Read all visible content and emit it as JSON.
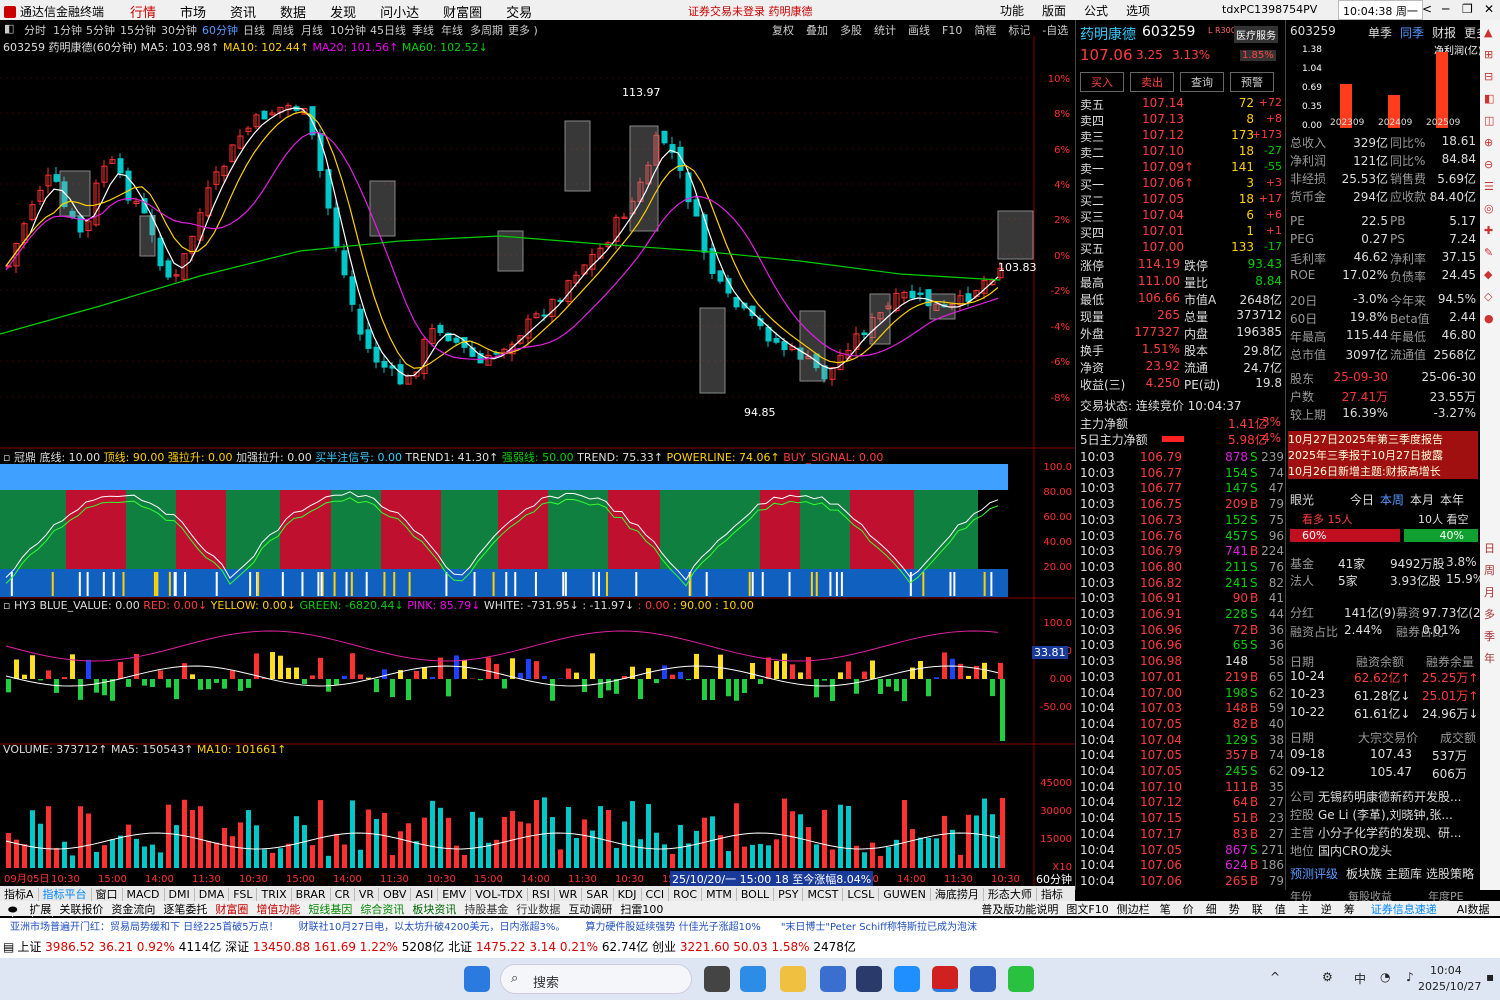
{
  "window": {
    "title": "通达信金融终端",
    "menus": [
      "行情",
      "市场",
      "资讯",
      "数据",
      "发现",
      "问小达",
      "财富圈",
      "交易"
    ],
    "active_menu": "行情",
    "notice": "证券交易未登录  药明康德",
    "right_menus": [
      "功能",
      "版面",
      "公式",
      "选项"
    ],
    "user": "tdxPC1398754PV",
    "clock": "10:04:38 周一"
  },
  "periods": [
    "分时",
    "1分钟",
    "5分钟",
    "15分钟",
    "30分钟",
    "60分钟",
    "日线",
    "周线",
    "月线",
    "10分钟",
    "45日线",
    "季线",
    "年线",
    "多周期",
    "更多 )"
  ],
  "active_period": "60分钟",
  "toolbar_right": [
    "复权",
    "叠加",
    "多股",
    "统计",
    "画线",
    "F10",
    "简框",
    "标记",
    "-自选",
    "返回"
  ],
  "chart": {
    "stock_header": "603259 药明康德(60分钟)",
    "ma5": "MA5: 103.98↑",
    "ma10": "MA10: 102.44↑",
    "ma20": "MA20: 101.56↑",
    "ma60": "MA60: 102.52↓",
    "high_label": "113.97",
    "low_label": "94.85",
    "last_label": "103.83",
    "pct_ticks": [
      "10%",
      "8%",
      "6%",
      "4%",
      "2%",
      "0%",
      "-2%",
      "-4%",
      "-6%",
      "-8%"
    ]
  },
  "ind1": {
    "name": "冠鼎",
    "items": [
      {
        "t": "底线: 10.00",
        "c": "wht"
      },
      {
        "t": "顶线: 90.00",
        "c": "yel"
      },
      {
        "t": "强拉升: 0.00",
        "c": "yel"
      },
      {
        "t": "加强拉升: 0.00",
        "c": "wht"
      },
      {
        "t": "买半注信号: 0.00",
        "c": "cyan"
      },
      {
        "t": "TREND1: 41.30↑",
        "c": "wht"
      },
      {
        "t": "强弱线: 50.00",
        "c": "green"
      },
      {
        "t": "TREND: 75.33↑",
        "c": "wht"
      },
      {
        "t": "POWERLINE: 74.06↑",
        "c": "yel"
      },
      {
        "t": "BUY_SIGNAL: 0.00",
        "c": "red"
      }
    ],
    "ticks": [
      "100.0",
      "80.00",
      "60.00",
      "40.00",
      "20.00"
    ]
  },
  "ind2": {
    "name": "HY3",
    "items": [
      {
        "t": "BLUE_VALUE: 0.00",
        "c": "wht"
      },
      {
        "t": "RED: 0.00↓",
        "c": "red"
      },
      {
        "t": "YELLOW: 0.00↓",
        "c": "yel"
      },
      {
        "t": "GREEN: -6820.44↓",
        "c": "green"
      },
      {
        "t": "PINK: 85.79↓",
        "c": "mag"
      },
      {
        "t": "WHITE: -731.95↓",
        "c": "wht"
      },
      {
        "t": ": -11.97↓",
        "c": "wht"
      },
      {
        "t": ": 0.00",
        "c": "red"
      },
      {
        "t": ": 90.00",
        "c": "yel"
      },
      {
        "t": ": 10.00",
        "c": "yel"
      }
    ],
    "ticks": [
      "100.0",
      "50.00",
      "0.00",
      "-50.00"
    ],
    "marker": "33.81"
  },
  "ind3": {
    "volume": "VOLUME: 373712↑",
    "ma5": "MA5: 150543↑",
    "ma10": "MA10: 101661↑",
    "ticks": [
      "45000",
      "30000",
      "15000",
      "X10"
    ],
    "tooltip": "25/10/20/一 15:00 18 至今涨幅8.04%"
  },
  "time_axis": [
    "09月05日",
    "10:30",
    "15:00",
    "14:00",
    "11:30",
    "10:30",
    "15:00",
    "14:00",
    "11:30",
    "10:30",
    "15:00",
    "14:00",
    "11:30",
    "10:30",
    "15:00",
    "14:00",
    "11:30",
    "10:30",
    "15:00",
    "14:00",
    "11:30",
    "10:30"
  ],
  "right": {
    "name": "药明康德",
    "code": "603259",
    "tag": "L R300",
    "service": "医疗服务",
    "price": "107.06",
    "change": "3.25",
    "pct": "3.13%",
    "service_pct": "1.85%",
    "buttons": [
      "买入",
      "卖出",
      "查询",
      "预警"
    ],
    "asks": [
      {
        "n": "卖五",
        "p": "107.14",
        "v": "72",
        "d": "+72"
      },
      {
        "n": "卖四",
        "p": "107.13",
        "v": "8",
        "d": "+8"
      },
      {
        "n": "卖三",
        "p": "107.12",
        "v": "173",
        "d": "+173"
      },
      {
        "n": "卖二",
        "p": "107.10",
        "v": "18",
        "d": "-27"
      },
      {
        "n": "卖一",
        "p": "107.09↑",
        "v": "141",
        "d": "-55"
      }
    ],
    "bids": [
      {
        "n": "买一",
        "p": "107.06↑",
        "v": "3",
        "d": "+3"
      },
      {
        "n": "买二",
        "p": "107.05",
        "v": "18",
        "d": "+17"
      },
      {
        "n": "买三",
        "p": "107.04",
        "v": "6",
        "d": "+6"
      },
      {
        "n": "买四",
        "p": "107.01",
        "v": "1",
        "d": "+1"
      },
      {
        "n": "买五",
        "p": "107.00",
        "v": "133",
        "d": "-17"
      }
    ],
    "stats": [
      [
        "涨停",
        "114.19",
        "跌停",
        "93.43"
      ],
      [
        "最高",
        "111.00",
        "量比",
        "8.84"
      ],
      [
        "最低",
        "106.66",
        "市值A",
        "2648亿"
      ],
      [
        "现量",
        "265",
        "总量",
        "373712"
      ],
      [
        "外盘",
        "177327",
        "内盘",
        "196385"
      ],
      [
        "换手",
        "1.51%",
        "股本",
        "29.8亿"
      ],
      [
        "净资",
        "23.92",
        "流通",
        "24.7亿"
      ],
      [
        "收益(三)",
        "4.250",
        "PE(动)",
        "19.8"
      ]
    ],
    "status": "交易状态: 连续竞价 10:04:37",
    "main_flow": "主力净额",
    "main_flow_v": "1.41亿",
    "main_flow_p": "3%",
    "main5": "5日主力净额",
    "main5_v": "5.98亿",
    "main5_p": "4%",
    "ticks": [
      [
        "10:03",
        "106.79",
        "878",
        "S",
        "239"
      ],
      [
        "10:03",
        "106.77",
        "154",
        "S",
        "74"
      ],
      [
        "10:03",
        "106.77",
        "147",
        "S",
        "47"
      ],
      [
        "10:03",
        "106.75",
        "209",
        "B",
        "79"
      ],
      [
        "10:03",
        "106.73",
        "152",
        "S",
        "75"
      ],
      [
        "10:03",
        "106.76",
        "457",
        "S",
        "96"
      ],
      [
        "10:03",
        "106.79",
        "741",
        "B",
        "224"
      ],
      [
        "10:03",
        "106.80",
        "211",
        "S",
        "76"
      ],
      [
        "10:03",
        "106.82",
        "241",
        "S",
        "82"
      ],
      [
        "10:03",
        "106.91",
        "90",
        "B",
        "41"
      ],
      [
        "10:03",
        "106.91",
        "228",
        "S",
        "44"
      ],
      [
        "10:03",
        "106.96",
        "72",
        "B",
        "36"
      ],
      [
        "10:03",
        "106.96",
        "65",
        "S",
        "36"
      ],
      [
        "10:03",
        "106.98",
        "148",
        "",
        "58"
      ],
      [
        "10:03",
        "107.01",
        "219",
        "B",
        "65"
      ],
      [
        "10:04",
        "107.00",
        "198",
        "S",
        "62"
      ],
      [
        "10:04",
        "107.03",
        "148",
        "B",
        "59"
      ],
      [
        "10:04",
        "107.05",
        "82",
        "B",
        "40"
      ],
      [
        "10:04",
        "107.04",
        "129",
        "S",
        "38"
      ],
      [
        "10:04",
        "107.05",
        "357",
        "B",
        "74"
      ],
      [
        "10:04",
        "107.05",
        "245",
        "S",
        "62"
      ],
      [
        "10:04",
        "107.10",
        "111",
        "B",
        "35"
      ],
      [
        "10:04",
        "107.12",
        "64",
        "B",
        "27"
      ],
      [
        "10:04",
        "107.15",
        "51",
        "B",
        "23"
      ],
      [
        "10:04",
        "107.17",
        "83",
        "B",
        "27"
      ],
      [
        "10:04",
        "107.05",
        "867",
        "S",
        "271"
      ],
      [
        "10:04",
        "107.06",
        "624",
        "B",
        "186"
      ],
      [
        "10:04",
        "107.06",
        "265",
        "B",
        "79"
      ]
    ]
  },
  "far": {
    "code": "603259",
    "tabs": [
      "单季",
      "同季",
      "财报",
      "更多.."
    ],
    "bar_legend": "净利润(亿)",
    "bar_y": [
      "1.38",
      "1.04",
      "0.69",
      "0.35",
      "0.00"
    ],
    "bar_x": [
      "202309",
      "202409",
      "202509"
    ],
    "bars": [
      0.8,
      0.6,
      1.38
    ],
    "fin": [
      [
        "总收入",
        "329亿",
        "同比%",
        "18.61"
      ],
      [
        "净利润",
        "121亿",
        "同比%",
        "84.84"
      ],
      [
        "非经损",
        "25.53亿",
        "销售费",
        "5.69亿"
      ],
      [
        "货币金",
        "294亿",
        "应收款",
        "84.40亿"
      ],
      [
        "PE",
        "22.5",
        "PB",
        "5.17"
      ],
      [
        "PEG",
        "0.27",
        "PS",
        "7.24"
      ],
      [
        "毛利率",
        "46.62",
        "净利率",
        "37.15"
      ],
      [
        "ROE",
        "17.02%",
        "负债率",
        "24.45"
      ],
      [
        "20日",
        "-3.0%",
        "今年来",
        "94.5%"
      ],
      [
        "60日",
        "19.8%",
        "Beta值",
        "2.44"
      ],
      [
        "年最高",
        "115.44",
        "年最低",
        "46.80"
      ],
      [
        "总市值",
        "3097亿",
        "流通值",
        "2568亿"
      ],
      [
        "股东",
        "25-09-30",
        "",
        "25-06-30"
      ],
      [
        "户数",
        "27.41万",
        "",
        "23.55万"
      ],
      [
        "较上期",
        "16.39%",
        "",
        "-3.27%"
      ]
    ],
    "news": [
      "10月27日2025年第三季度报告",
      "2025年三季报于10月27日披露",
      "10月26日新增主题:财报高增长"
    ],
    "sent_tabs": [
      "眼光",
      "今日",
      "本周",
      "本月",
      "本年"
    ],
    "bull": "看多 15人",
    "bear": "10人 看空",
    "bull_pct": "60%",
    "bear_pct": "40%",
    "holders": [
      [
        "基金",
        "41家",
        "9492万股",
        "3.8%"
      ],
      [
        "法人",
        "5家",
        "3.93亿股",
        "15.9%"
      ]
    ],
    "fin2": [
      [
        "分红",
        "141亿(9)",
        "募资",
        "97.73亿(24)"
      ],
      [
        "融资占比",
        "2.44%",
        "融券占比",
        "0.01%"
      ]
    ],
    "margin_head": [
      "日期",
      "融资余额",
      "融券余量"
    ],
    "margin": [
      [
        "10-24",
        "62.62亿↑",
        "25.25万↑"
      ],
      [
        "10-23",
        "61.28亿↓",
        "25.01万↑"
      ],
      [
        "10-22",
        "61.61亿↓",
        "24.96万↓"
      ]
    ],
    "block_head": [
      "日期",
      "大宗交易价",
      "成交额"
    ],
    "block": [
      [
        "09-18",
        "107.43",
        "537万"
      ],
      [
        "09-12",
        "105.47",
        "606万"
      ]
    ],
    "company": [
      [
        "公司",
        "无锡药明康德新药开发股..."
      ],
      [
        "控股",
        "Ge Li (李革),刘晓钟,张..."
      ],
      [
        "主营",
        "小分子化学药的发现、研..."
      ],
      [
        "地位",
        "国内CRO龙头"
      ]
    ],
    "forecast": "预测评级",
    "forecast_links": [
      "板块族",
      "主题库",
      "选股策略"
    ],
    "year_row": [
      "年份",
      "每股收益",
      "年度PE"
    ]
  },
  "right_tabs": [
    "笔",
    "价",
    "细",
    "势",
    "联",
    "值",
    "主",
    "逆",
    "筹"
  ],
  "bottom_tabs": [
    "指标A",
    "指标平台",
    "窗口",
    "MACD",
    "DMI",
    "DMA",
    "FSL",
    "TRIX",
    "BRAR",
    "CR",
    "VR",
    "OBV",
    "ASI",
    "EMV",
    "VOL-TDX",
    "RSI",
    "WR",
    "SAR",
    "KDJ",
    "CCI",
    "ROC",
    "MTM",
    "BOLL",
    "PSY",
    "MCST",
    "LCSL",
    "GUWEN",
    "海底捞月",
    "形态大师",
    "指标B",
    "模",
    "板"
  ],
  "bottom_tabs2": [
    "扩展",
    "关联报价",
    "资金流向",
    "逐笔委托",
    "财富圈",
    "增值功能",
    "短线基因",
    "综合资讯",
    "板块资讯",
    "持股基金",
    "行业数据",
    "互动调研",
    "扫雷100"
  ],
  "bottom_right": [
    "普及版功能说明",
    "图文F10",
    "侧边栏"
  ],
  "far_bottom": [
    "证券信息速递",
    "AI数据分析"
  ],
  "news_ticker": [
    "亚洲市场普遍开门红：贸易局势缓和下 日经225首破5万点！",
    "财联社10月27日电，以太坊升破4200美元，日内涨超3%。",
    "算力硬件股延续强势 什佳光子涨超10%",
    "\"末日博士\"Peter Schiff称特斯拉已成为泡沫",
    "Peter Schiff称特斯拉已成为"
  ],
  "indexes": [
    {
      "n": "上证",
      "v": "3986.52",
      "c": "36.21",
      "p": "0.92%",
      "a": "4114亿"
    },
    {
      "n": "深证",
      "v": "13450.88",
      "c": "161.69",
      "p": "1.22%",
      "a": "5208亿"
    },
    {
      "n": "北证",
      "v": "1475.22",
      "c": "3.14",
      "p": "0.21%",
      "a": "62.74亿"
    },
    {
      "n": "创业",
      "v": "3221.60",
      "c": "50.03",
      "p": "1.58%",
      "a": "2478亿"
    }
  ],
  "taskbar": {
    "search": "搜索",
    "time": "10:04",
    "date": "2025/10/27",
    "lang": "中"
  }
}
